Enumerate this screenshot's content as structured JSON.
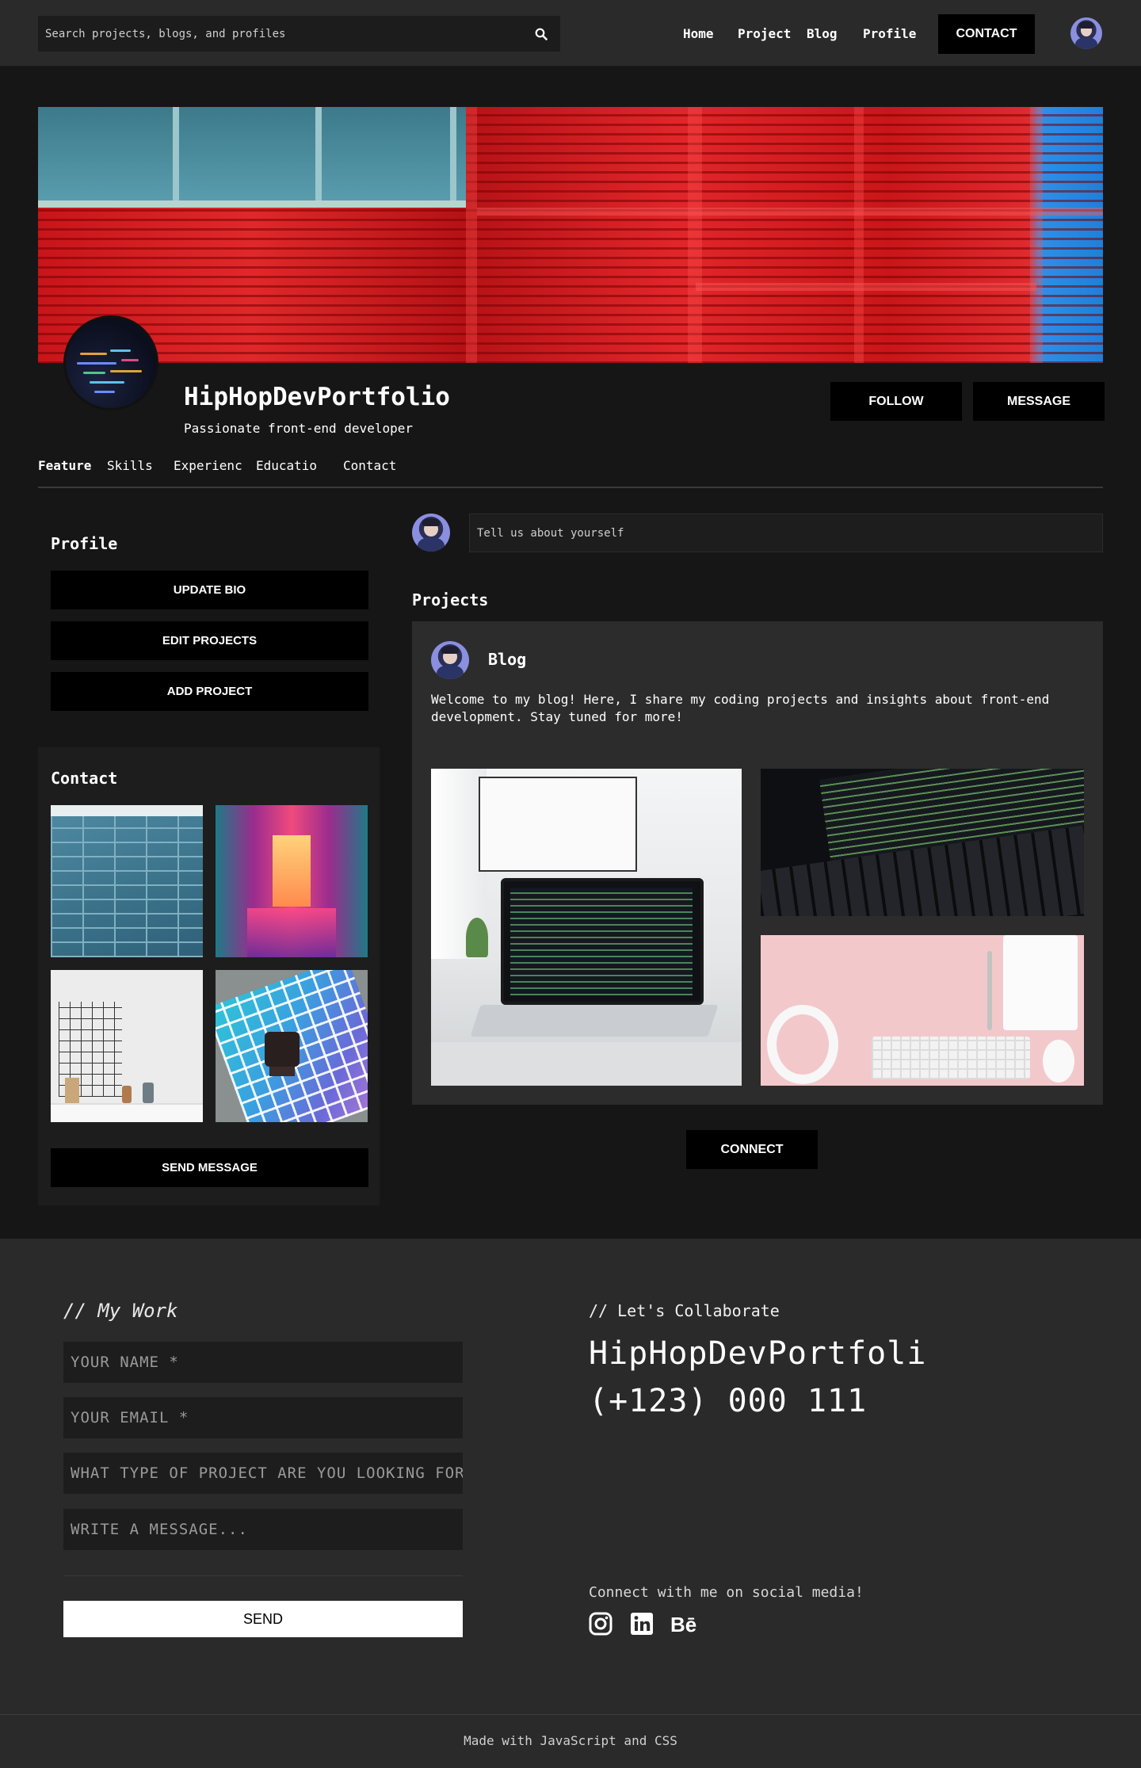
{
  "topnav": {
    "search_placeholder": "Search projects, blogs, and profiles",
    "links": [
      "Home",
      "Project",
      "Blog",
      "Profile"
    ],
    "contact_label": "CONTACT"
  },
  "profile": {
    "name": "HipHopDevPortfolio",
    "tagline": "Passionate front-end developer",
    "follow_label": "FOLLOW",
    "message_label": "MESSAGE"
  },
  "tabs": [
    "Featured",
    "Skills",
    "Experience",
    "Education",
    "Contact"
  ],
  "sidebar": {
    "profile_title": "Profile",
    "buttons": [
      "UPDATE BIO",
      "EDIT PROJECTS",
      "ADD PROJECT"
    ],
    "contact_title": "Contact",
    "send_message_label": "SEND MESSAGE"
  },
  "main": {
    "post_placeholder": "Tell us about yourself",
    "projects_title": "Projects",
    "blog_title": "Blog",
    "blog_text": "Welcome to my blog! Here, I share my coding projects and insights about front-end development. Stay tuned for more!",
    "connect_label": "CONNECT"
  },
  "footer": {
    "my_work": "// My Work",
    "name_placeholder": "YOUR NAME *",
    "email_placeholder": "YOUR EMAIL *",
    "project_placeholder": "WHAT TYPE OF PROJECT ARE YOU LOOKING FOR?",
    "message_placeholder": "WRITE A MESSAGE...",
    "send_label": "SEND",
    "collab": "// Let's Collaborate",
    "brand": "HipHopDevPortfoli",
    "phone": "(+123) 000 111",
    "social_text": "Connect with me on social media!",
    "behance_label": "Bē",
    "bottom_text": "Made with JavaScript and CSS"
  },
  "icons": [
    "search-icon",
    "instagram-icon",
    "linkedin-icon",
    "behance-icon"
  ]
}
